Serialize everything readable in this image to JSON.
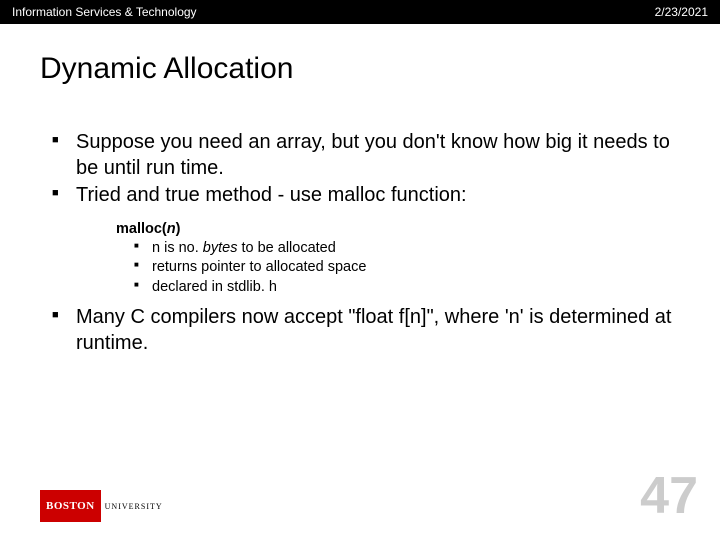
{
  "header": {
    "left": "Information Services & Technology",
    "right": "2/23/2021"
  },
  "title": "Dynamic Allocation",
  "bullets": {
    "b1": "Suppose you need an array, but you don't know how big it needs to be until run time.",
    "b2": "Tried and true method - use malloc function:",
    "b3": "Many C compilers now accept \"float f[n]\", where 'n' is determined at runtime."
  },
  "malloc": {
    "name": "malloc(",
    "arg": "n",
    "close": ")",
    "s1a": "n is no. ",
    "s1b": "bytes",
    "s1c": " to be allocated",
    "s2": "returns pointer to allocated space",
    "s3": "declared in stdlib. h"
  },
  "logo": {
    "red": "BOSTON",
    "text": "UNIVERSITY"
  },
  "page": "47"
}
